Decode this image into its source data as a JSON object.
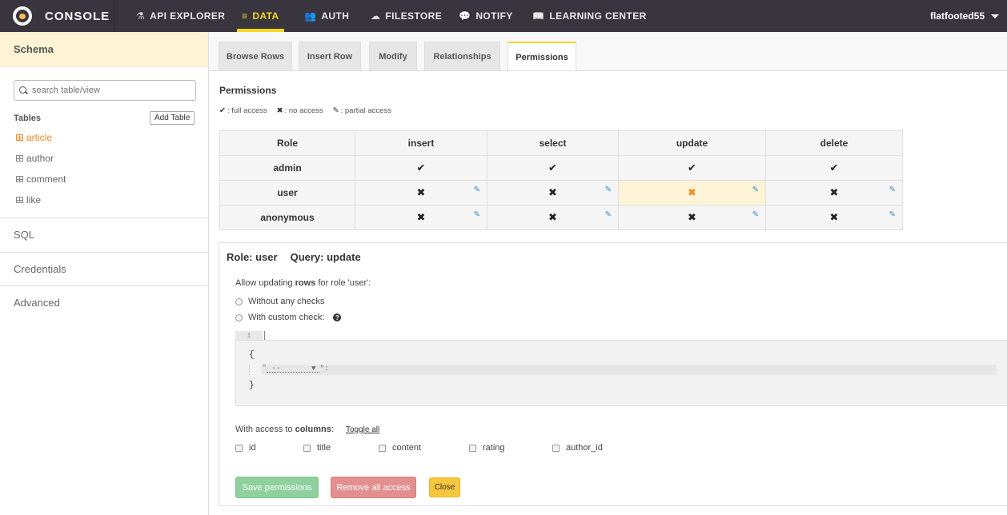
{
  "brand": {
    "title": "CONSOLE"
  },
  "nav": {
    "items": [
      {
        "label": "API EXPLORER",
        "icon": "flask-icon"
      },
      {
        "label": "DATA",
        "icon": "database-icon"
      },
      {
        "label": "AUTH",
        "icon": "users-icon"
      },
      {
        "label": "FILESTORE",
        "icon": "cloud-upload-icon"
      },
      {
        "label": "NOTIFY",
        "icon": "comment-icon"
      },
      {
        "label": "LEARNING CENTER",
        "icon": "book-icon"
      }
    ],
    "user": "flatfooted55"
  },
  "sidebar": {
    "header": "Schema",
    "search_placeholder": "search table/view",
    "tables_label": "Tables",
    "add_table": "Add Table",
    "tables": [
      "article",
      "author",
      "comment",
      "like"
    ],
    "sections": [
      "SQL",
      "Credentials",
      "Advanced"
    ]
  },
  "tabs": [
    "Browse Rows",
    "Insert Row",
    "Modify",
    "Relationships",
    "Permissions"
  ],
  "permissions": {
    "title": "Permissions",
    "legend": [
      ": full access",
      ": no access",
      ": partial access"
    ],
    "headers": [
      "Role",
      "insert",
      "select",
      "update",
      "delete"
    ],
    "rows": [
      {
        "role": "admin",
        "cells": [
          "✔",
          "✔",
          "✔",
          "✔"
        ]
      },
      {
        "role": "user",
        "cells": [
          "✖",
          "✖",
          "✖",
          "✖"
        ]
      },
      {
        "role": "anonymous",
        "cells": [
          "✖",
          "✖",
          "✖",
          "✖"
        ]
      }
    ]
  },
  "editor": {
    "role_label": "Role: user",
    "query_label": "Query: update",
    "allow_prefix": "Allow updating ",
    "allow_bold": "rows",
    "allow_suffix": " for role 'user':",
    "option1": "Without any checks",
    "option2": "With custom check:",
    "line_no": "1",
    "code_open": "{",
    "code_placeholder": "\" --",
    "code_close": "}",
    "cols_prefix": "With access to ",
    "cols_bold": "columns",
    "cols_suffix": ":",
    "toggle_all": "Toggle all",
    "columns": [
      "id",
      "title",
      "content",
      "rating",
      "author_id"
    ],
    "save": "Save permissions",
    "remove": "Remove all access",
    "close": "Close"
  }
}
